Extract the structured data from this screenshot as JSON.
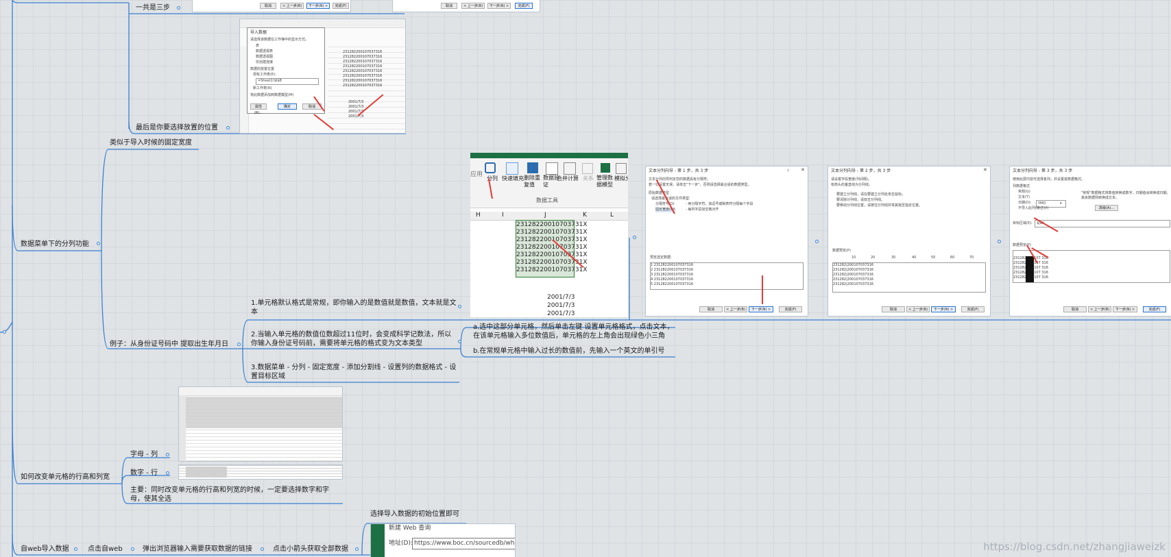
{
  "colors": {
    "line": "#3a7fd0",
    "node_dot": "#3a7fd0",
    "arrow": "#e53935",
    "excel_green": "#1d7044"
  },
  "nodes": {
    "three_steps": "一共是三步",
    "last_choose": "最后是你要选择放置的位置",
    "similar_fixed_width": "类似于导入时候的固定宽度",
    "split_column": "数据菜单下的分列功能",
    "example": "例子：从身份证号码中 提取出生年月日",
    "step1": "1.单元格默认格式是常规，即你输入的是数值就是数值，文本就是文本",
    "step2": "2.当输入单元格的数值位数超过11位时，会变成科学记数法，所以你输入身份证号码前，需要将单元格的格式变为文本类型",
    "step2a": "a.选中这部分单元格，然后单击左键 设置单元格格式，点击文本，在该单元格输入多位数值后，单元格的左上角会出现绿色小三角",
    "step2b": "b.在常规单元格中输入过长的数值前，先输入一个英文的单引号",
    "step3": "3.数据菜单 - 分列 - 固定宽度 - 添加分割线 - 设置列的数据格式 - 设置目标区域",
    "row_col": "如何改变单元格的行高和列宽",
    "letter_col": "字母 - 列",
    "number_row": "数字 - 行",
    "note": "主要：同时改变单元格的行高和列宽的时候，一定要选择数字和字母，使其全选",
    "web_import": "自web导入数据",
    "click_web": "点击自web",
    "browser_link": "弹出浏览器输入需要获取数据的链接",
    "click_arrow": "点击小箭头获取全部数据",
    "choose_start": "选择导入数据的初始位置即可"
  },
  "import_dialog": {
    "title": "导入数据",
    "prompt": "请选择该数据在工作簿中的显示方式。",
    "opt_table": "表",
    "opt_pivot": "数据透视表",
    "opt_pivot_chart": "数据透视图",
    "opt_conn": "仅创建连接",
    "place_label": "数据的放置位置",
    "existing": "现有工作表(E):",
    "existing_value": "=Sheet1!$I$8",
    "new_sheet": "新工作表(N)",
    "add_model": "将此数据添加到数据模型(M)",
    "props_btn": "属性(R)...",
    "ok_btn": "确定",
    "cancel_btn": "取消"
  },
  "top_dialog_buttons": {
    "cancel": "取消",
    "prev": "< 上一步(B)",
    "next": "下一步(N) >",
    "finish": "完成(F)"
  },
  "ribbon": {
    "items": [
      "分列",
      "快速填充",
      "删除重复值",
      "数据验证",
      "合并计算",
      "关系",
      "管理数据模型",
      "模拟分析"
    ],
    "group": "数据工具",
    "left_fragment": "应用"
  },
  "excel_columns": [
    "H",
    "I",
    "J",
    "K",
    "L"
  ],
  "id_values": [
    "231282200107037316",
    "231282200107037316",
    "231282200107037316",
    "231282200107037316",
    "231282200107037316",
    "231282200107037316",
    "231282200107037316"
  ],
  "id_display": [
    "2312822001070373​1X",
    "231282200107037​31X",
    "231282200107037​31X",
    "231282200107037​31X",
    "231282200107037​31X",
    "231282200107037​31X",
    "231282200107037​31X"
  ],
  "date_values": [
    "2001/7/3",
    "2001/7/3",
    "2001/7/3"
  ],
  "import_rows_dates": [
    "2001/7/3",
    "2001/7/3",
    "2001/7/3",
    "2001/7/3"
  ],
  "wizard1": {
    "title": "文本分列向导 - 第 1 步，共 3 步",
    "q": "?",
    "line1": "文本分列向导判定您的数据具有分隔符。",
    "line2": "若一切设置无误，请单击\"下一步\"，否则请选择最合适的数据类型。",
    "section": "原始数据类型",
    "choose": "请选择最合适的文件类型:",
    "opt_delim": "分隔符号(D)",
    "opt_delim_desc": "- 用分隔字符，如逗号或制表符分隔每个字段",
    "opt_fixed": "固定宽度(W)",
    "opt_fixed_desc": "- 每列字段加空格对齐",
    "preview": "预览选定数据:",
    "btn_cancel": "取消",
    "btn_prev": "< 上一步(B)",
    "btn_next": "下一步(N) >",
    "btn_finish": "完成(F)"
  },
  "wizard2": {
    "title": "文本分列向导 - 第 2 步，共 3 步",
    "line1": "请设置字段宽度(列间隔)。",
    "line2": "有箭头的垂直线为分列线。",
    "l3": "要建立分列线，请在要建立分列处单击鼠标。",
    "l4": "要清除分列线，请双击分列线。",
    "l5": "要移动分列线位置，请按住分列线并将其拖至指定位置。",
    "preview": "数据预览(P)",
    "ruler": [
      "10",
      "20",
      "30",
      "40",
      "50",
      "60",
      "70"
    ],
    "btn_cancel": "取消",
    "btn_prev": "< 上一步(B)",
    "btn_next": "下一步(N) >",
    "btn_finish": "完成(F)"
  },
  "wizard3": {
    "title": "文本分列向导 - 第 3 步，共 3 步",
    "line1": "使用此屏内容可选择各列，并设置其数据格式。",
    "section": "列数据格式",
    "opt_general": "常规(G)",
    "opt_text": "文本(T)",
    "opt_date": "日期(D):",
    "date_fmt": "YMD",
    "opt_skip": "不导入此列(跳过)(I)",
    "desc": "\"常规\"数据格式将数值转换成数字，日期值会转换成日期，其余数据则转换成文本。",
    "adv": "高级(A)...",
    "target": "目标区域(E):",
    "target_value": "$J$1",
    "preview": "数据预览(P)",
    "btn_cancel": "取消",
    "btn_prev": "< 上一步(B)",
    "btn_next": "下一步(N) >",
    "btn_finish": "完成(F)"
  },
  "web_dialog": {
    "title": "新建 Web 查询",
    "address_label": "地址(D):",
    "address": "https://www.boc.cn/sourcedb/wh"
  },
  "watermark": "https://blog.csdn.net/zhangjiaweizk"
}
